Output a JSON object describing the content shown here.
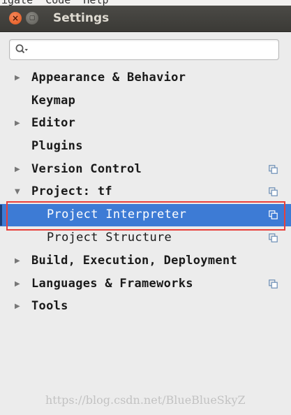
{
  "menubar": {
    "text": "igate  Code  Help"
  },
  "window": {
    "title": "Settings",
    "close_glyph": "×",
    "minimize_glyph": "▢"
  },
  "search": {
    "value": "",
    "placeholder": ""
  },
  "tree": [
    {
      "label": "Appearance & Behavior",
      "expandable": true,
      "expanded": false,
      "copy_icon": false,
      "selected": false,
      "bold": true
    },
    {
      "label": "Keymap",
      "expandable": false,
      "expanded": false,
      "copy_icon": false,
      "selected": false,
      "bold": true
    },
    {
      "label": "Editor",
      "expandable": true,
      "expanded": false,
      "copy_icon": false,
      "selected": false,
      "bold": true
    },
    {
      "label": "Plugins",
      "expandable": false,
      "expanded": false,
      "copy_icon": false,
      "selected": false,
      "bold": true
    },
    {
      "label": "Version Control",
      "expandable": true,
      "expanded": false,
      "copy_icon": true,
      "selected": false,
      "bold": true
    },
    {
      "label": "Project: tf",
      "expandable": true,
      "expanded": true,
      "copy_icon": true,
      "selected": false,
      "bold": true
    },
    {
      "label": "Project Interpreter",
      "expandable": false,
      "expanded": false,
      "copy_icon": true,
      "selected": true,
      "bold": false
    },
    {
      "label": "Project Structure",
      "expandable": false,
      "expanded": false,
      "copy_icon": true,
      "selected": false,
      "bold": false
    },
    {
      "label": "Build, Execution, Deployment",
      "expandable": true,
      "expanded": false,
      "copy_icon": false,
      "selected": false,
      "bold": true
    },
    {
      "label": "Languages & Frameworks",
      "expandable": true,
      "expanded": false,
      "copy_icon": true,
      "selected": false,
      "bold": true
    },
    {
      "label": "Tools",
      "expandable": true,
      "expanded": false,
      "copy_icon": false,
      "selected": false,
      "bold": true
    }
  ],
  "watermark": "https://blog.csdn.net/BlueBlueSkyZ",
  "colors": {
    "selection": "#3d7bd5",
    "highlight_border": "#e8403a",
    "titlebar": "#3c3b37",
    "close_button": "#e95420"
  }
}
